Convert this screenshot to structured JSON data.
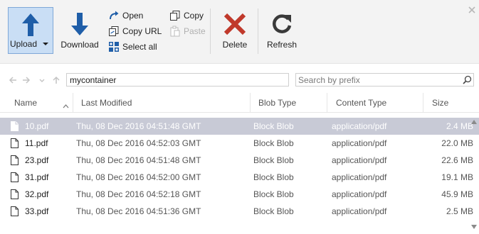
{
  "toolbar": {
    "upload_label": "Upload",
    "download_label": "Download",
    "open_label": "Open",
    "copy_url_label": "Copy URL",
    "select_all_label": "Select all",
    "copy_label": "Copy",
    "paste_label": "Paste",
    "delete_label": "Delete",
    "refresh_label": "Refresh"
  },
  "address": {
    "path": "mycontainer",
    "search_placeholder": "Search by prefix"
  },
  "table": {
    "columns": {
      "name": "Name",
      "last_modified": "Last Modified",
      "blob_type": "Blob Type",
      "content_type": "Content Type",
      "size": "Size"
    },
    "rows": [
      {
        "name": "10.pdf",
        "modified": "Thu, 08 Dec 2016 04:51:48 GMT",
        "blob_type": "Block Blob",
        "content_type": "application/pdf",
        "size": "2.4 MB",
        "selected": true
      },
      {
        "name": "11.pdf",
        "modified": "Thu, 08 Dec 2016 04:52:03 GMT",
        "blob_type": "Block Blob",
        "content_type": "application/pdf",
        "size": "22.0 MB",
        "selected": false
      },
      {
        "name": "23.pdf",
        "modified": "Thu, 08 Dec 2016 04:51:48 GMT",
        "blob_type": "Block Blob",
        "content_type": "application/pdf",
        "size": "22.6 MB",
        "selected": false
      },
      {
        "name": "31.pdf",
        "modified": "Thu, 08 Dec 2016 04:52:00 GMT",
        "blob_type": "Block Blob",
        "content_type": "application/pdf",
        "size": "19.1 MB",
        "selected": false
      },
      {
        "name": "32.pdf",
        "modified": "Thu, 08 Dec 2016 04:52:18 GMT",
        "blob_type": "Block Blob",
        "content_type": "application/pdf",
        "size": "45.9 MB",
        "selected": false
      },
      {
        "name": "33.pdf",
        "modified": "Thu, 08 Dec 2016 04:51:36 GMT",
        "blob_type": "Block Blob",
        "content_type": "application/pdf",
        "size": "2.5 MB",
        "selected": false
      }
    ]
  },
  "colors": {
    "accent_blue": "#1f5ea8",
    "delete_red": "#c0392b",
    "selected_row": "#c8cad6",
    "upload_highlight": "#c9def5"
  },
  "icons": [
    "upload-icon",
    "download-icon",
    "open-icon",
    "copy-url-icon",
    "select-all-icon",
    "copy-icon",
    "paste-icon",
    "delete-icon",
    "refresh-icon",
    "close-icon",
    "back-arrow-icon",
    "forward-arrow-icon",
    "history-dropdown-icon",
    "up-arrow-icon",
    "search-icon",
    "file-icon",
    "sort-ascending-icon"
  ]
}
